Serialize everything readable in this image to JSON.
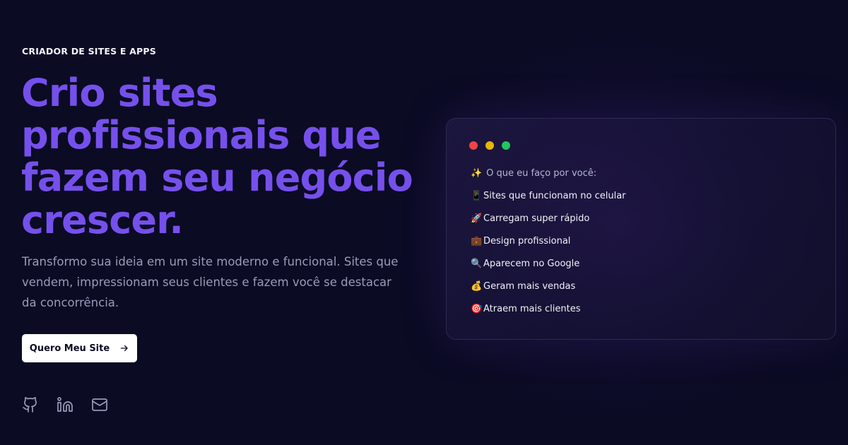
{
  "hero": {
    "eyebrow": "CRIADOR DE SITES E APPS",
    "headline": "Crio sites profissionais que fazem seu negócio crescer.",
    "subtitle": "Transformo sua ideia em um site moderno e funcional. Sites que vendem, impressionam seus clientes e fazem você se destacar da concorrência.",
    "cta_label": "Quero Meu Site",
    "cta_icon": "arrow-right-icon"
  },
  "socials": [
    {
      "icon": "github-icon"
    },
    {
      "icon": "linkedin-icon"
    },
    {
      "icon": "mail-icon"
    }
  ],
  "card": {
    "window_dots": [
      "#ef4444",
      "#eab308",
      "#22c55e"
    ],
    "title_emoji": "✨",
    "title": "O que eu faço por você:",
    "items": [
      {
        "emoji": "📱",
        "text": "Sites que funcionam no celular"
      },
      {
        "emoji": "🚀",
        "text": "Carregam super rápido"
      },
      {
        "emoji": "💼",
        "text": "Design profissional"
      },
      {
        "emoji": "🔍",
        "text": "Aparecem no Google"
      },
      {
        "emoji": "💰",
        "text": "Geram mais vendas"
      },
      {
        "emoji": "🎯",
        "text": "Atraem mais clientes"
      }
    ]
  },
  "colors": {
    "background": "#0b0b24",
    "accent": "#7650ec",
    "muted_text": "#9a9bb8"
  }
}
